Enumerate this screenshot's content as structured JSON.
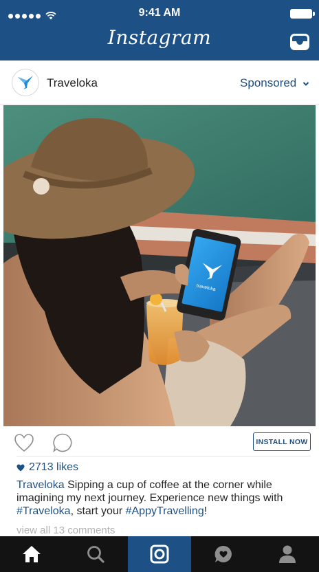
{
  "status_bar": {
    "time": "9:41 AM",
    "signal_dots": 5,
    "wifi_icon": "wifi-icon",
    "battery_icon": "battery-icon"
  },
  "header": {
    "app_title": "Instagram",
    "inbox_icon": "inbox-tray-icon"
  },
  "post": {
    "account_name": "Traveloka",
    "sponsored_label": "Sponsored",
    "sponsored_icon": "chevron-down-icon",
    "image_description_icon": "photo",
    "phone_brand_text": "traveloka",
    "actions": {
      "like_icon": "heart-outline-icon",
      "comment_icon": "comment-bubble-icon",
      "install_label": "INSTALL NOW"
    },
    "likes_text": "2713 likes",
    "caption": {
      "author": "Traveloka",
      "text_1": " Sipping a cup of coffee at the corner while imagining my next journey. Experience new things with ",
      "tag_1": "#Traveloka",
      "text_2": ", start your ",
      "tag_2": "#AppyTravelling",
      "text_3": "!"
    },
    "view_comments": "view all 13 comments"
  },
  "tabbar": {
    "items": [
      {
        "icon": "home-icon",
        "active": false
      },
      {
        "icon": "search-icon",
        "active": false
      },
      {
        "icon": "camera-icon",
        "active": true
      },
      {
        "icon": "activity-bubble-icon",
        "active": false
      },
      {
        "icon": "profile-icon",
        "active": false
      }
    ]
  },
  "colors": {
    "brand_blue": "#1d5084",
    "tabbar_bg": "#131313",
    "muted_text": "#b3b3b3"
  }
}
